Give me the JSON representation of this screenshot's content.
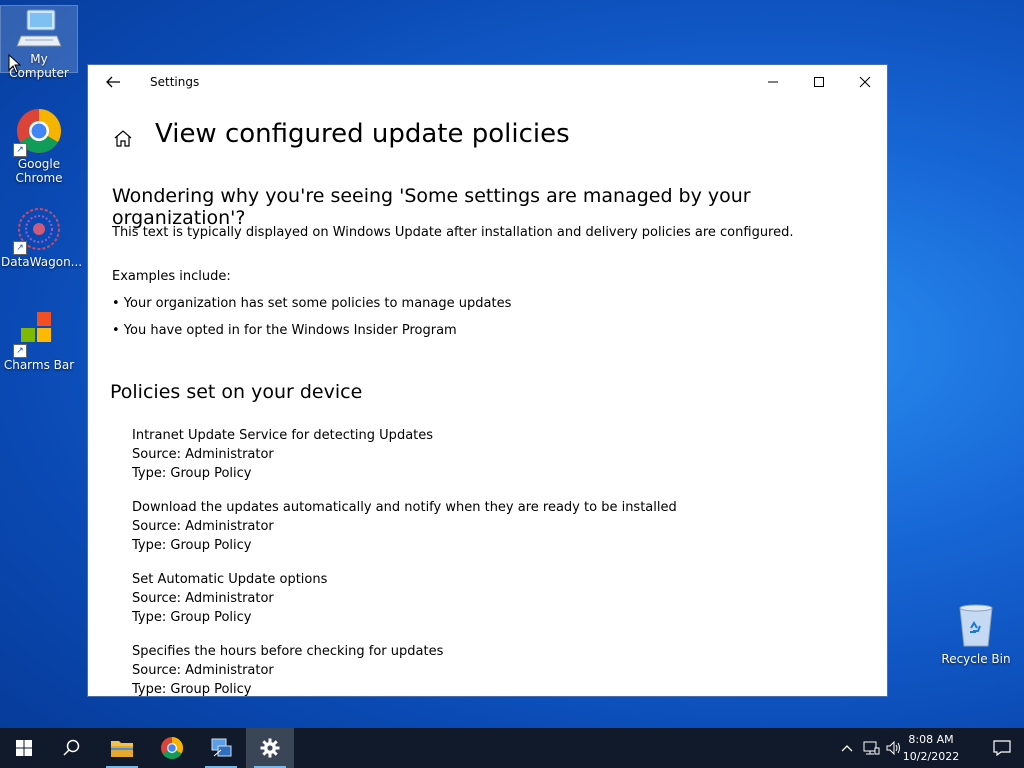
{
  "desktop": {
    "icons": [
      {
        "label": "My Computer"
      },
      {
        "label": "Google Chrome"
      },
      {
        "label": "DataWagon..."
      },
      {
        "label": "Charms Bar"
      }
    ],
    "recycle_bin": "Recycle Bin"
  },
  "window": {
    "title": "Settings",
    "page_title": "View configured update policies",
    "question_heading": "Wondering why you're seeing 'Some settings are managed by your organization'?",
    "description": "This text is typically displayed on Windows Update after installation and delivery policies are configured.",
    "examples_label": "Examples include:",
    "examples": [
      "• Your organization has set some policies to manage updates",
      "• You have opted in for the Windows Insider Program"
    ],
    "policies_heading": "Policies set on your device",
    "policies": [
      {
        "name": "Intranet Update Service for detecting Updates",
        "source": "Source: Administrator",
        "type": "Type: Group Policy"
      },
      {
        "name": "Download the updates automatically and notify when they are ready to be installed",
        "source": "Source: Administrator",
        "type": "Type: Group Policy"
      },
      {
        "name": "Set Automatic Update options",
        "source": "Source: Administrator",
        "type": "Type: Group Policy"
      },
      {
        "name": "Specifies the hours before checking for updates",
        "source": "Source: Administrator",
        "type": "Type: Group Policy"
      }
    ]
  },
  "taskbar": {
    "time": "8:08 AM",
    "date": "10/2/2022"
  },
  "colors": {
    "accent": "#0078d7",
    "taskbar": "#101a2a"
  }
}
